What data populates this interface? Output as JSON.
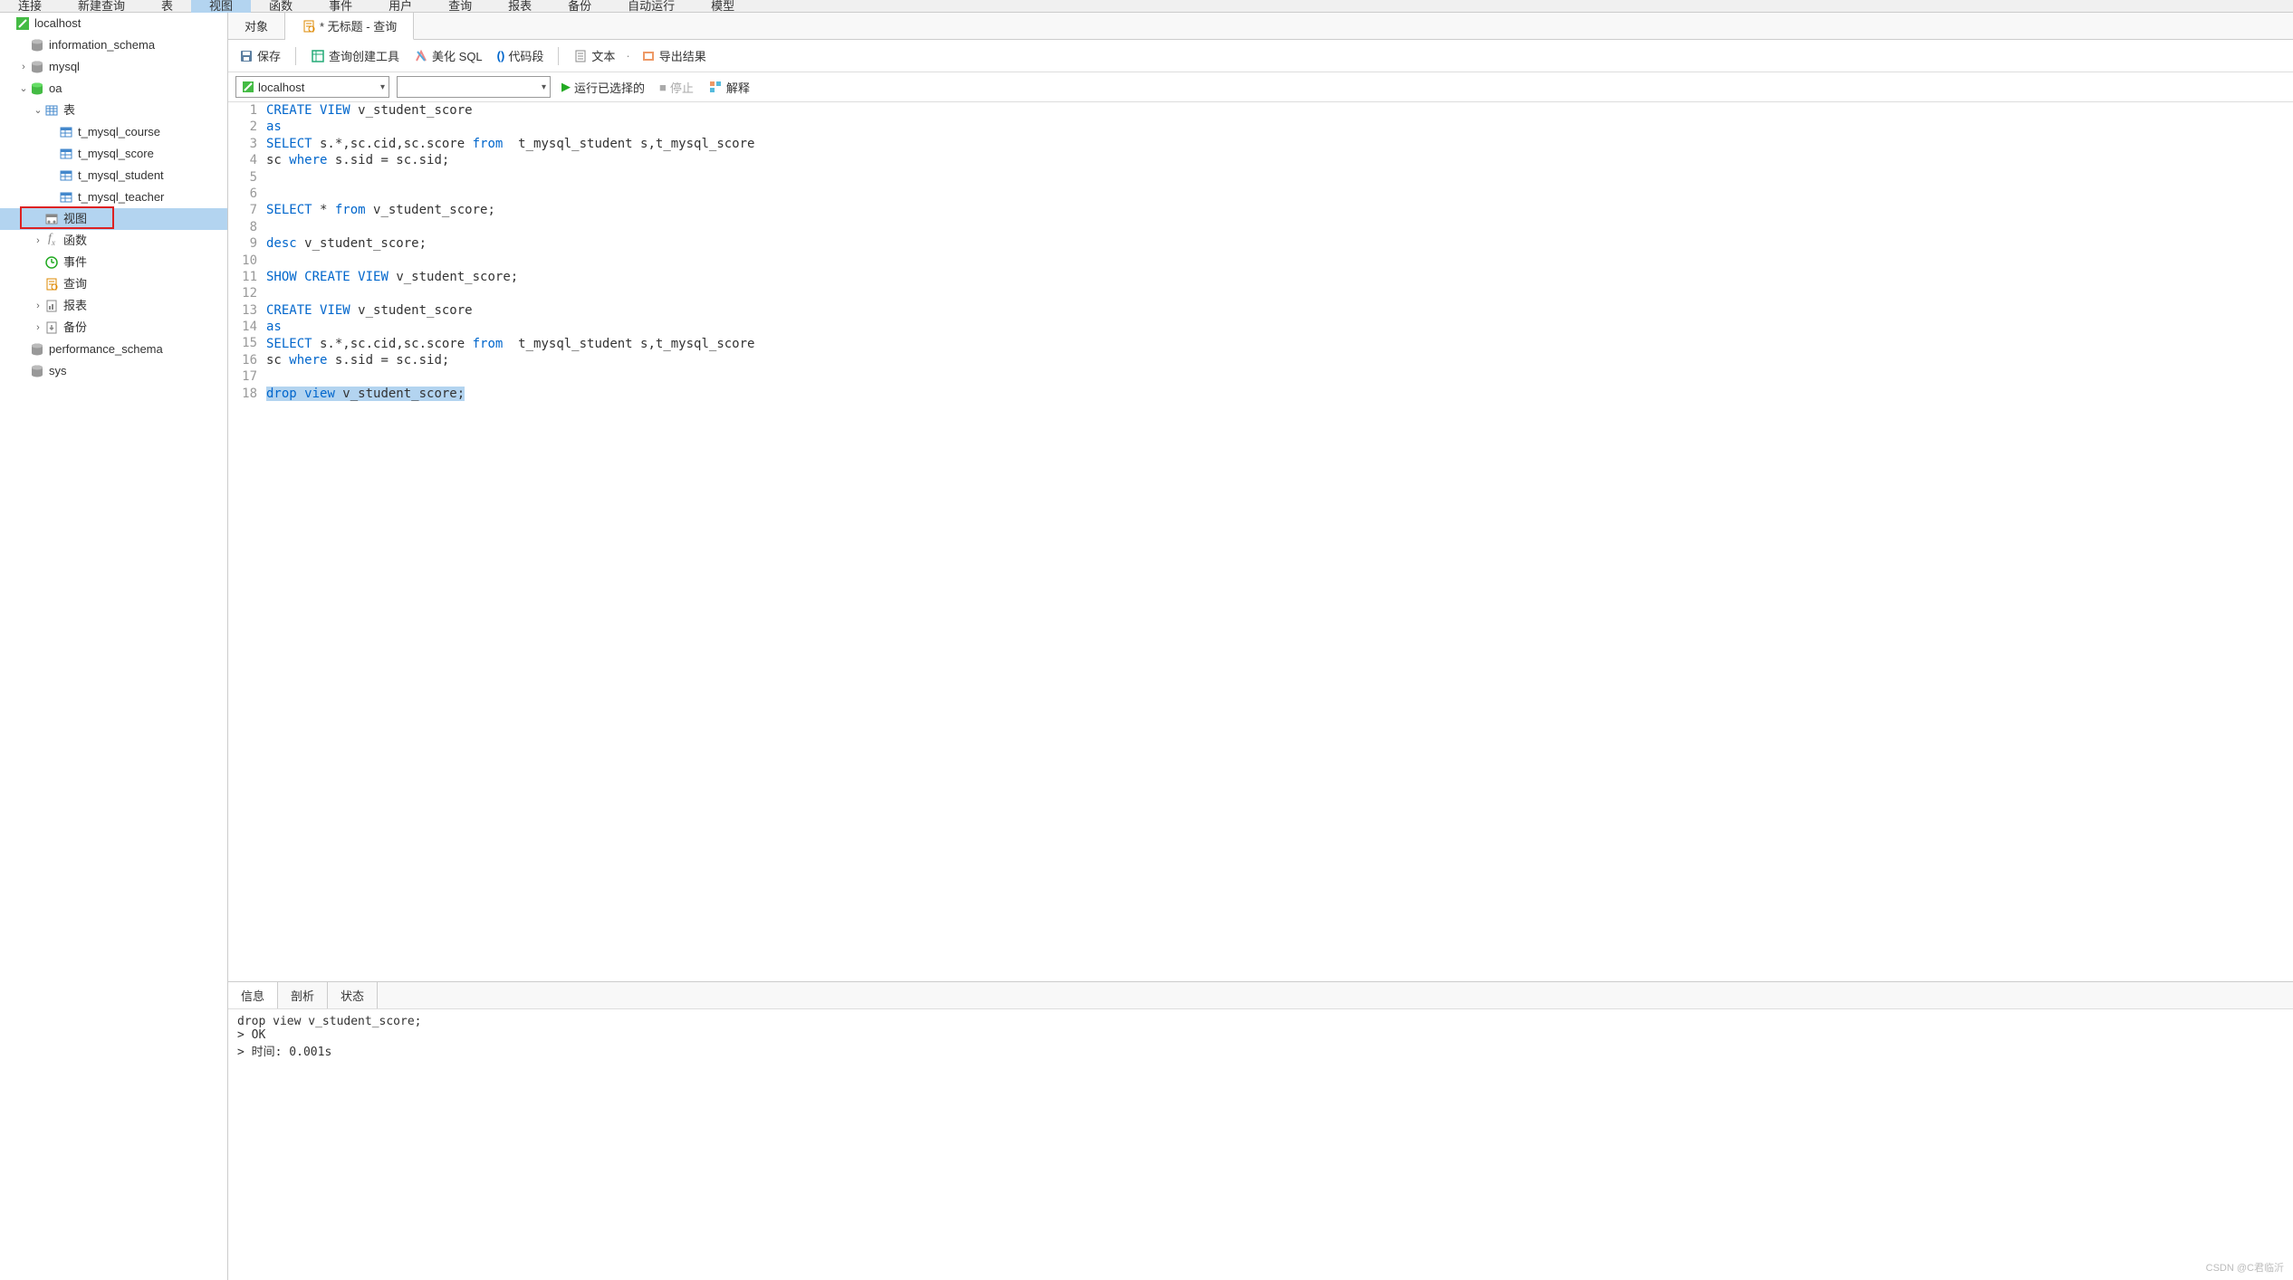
{
  "menu": {
    "items": [
      "连接",
      "新建查询",
      "表",
      "视图",
      "函数",
      "事件",
      "用户",
      "查询",
      "报表",
      "备份",
      "自动运行",
      "模型"
    ],
    "active_index": 3
  },
  "sidebar": {
    "nodes": [
      {
        "label": "localhost",
        "icon": "connection-icon",
        "indent": 0,
        "toggle": null
      },
      {
        "label": "information_schema",
        "icon": "database-icon",
        "indent": 1,
        "toggle": null
      },
      {
        "label": "mysql",
        "icon": "database-icon",
        "indent": 1,
        "toggle": "closed"
      },
      {
        "label": "oa",
        "icon": "database-icon-open",
        "indent": 1,
        "toggle": "open"
      },
      {
        "label": "表",
        "icon": "tables-icon",
        "indent": 2,
        "toggle": "open"
      },
      {
        "label": "t_mysql_course",
        "icon": "table-icon",
        "indent": 3,
        "toggle": null
      },
      {
        "label": "t_mysql_score",
        "icon": "table-icon",
        "indent": 3,
        "toggle": null
      },
      {
        "label": "t_mysql_student",
        "icon": "table-icon",
        "indent": 3,
        "toggle": null
      },
      {
        "label": "t_mysql_teacher",
        "icon": "table-icon",
        "indent": 3,
        "toggle": null
      },
      {
        "label": "视图",
        "icon": "view-icon",
        "indent": 2,
        "toggle": null,
        "selected": true,
        "redbox": true
      },
      {
        "label": "函数",
        "icon": "function-icon",
        "indent": 2,
        "toggle": "closed"
      },
      {
        "label": "事件",
        "icon": "event-icon",
        "indent": 2,
        "toggle": null
      },
      {
        "label": "查询",
        "icon": "query-icon",
        "indent": 2,
        "toggle": null
      },
      {
        "label": "报表",
        "icon": "report-icon",
        "indent": 2,
        "toggle": "closed"
      },
      {
        "label": "备份",
        "icon": "backup-icon",
        "indent": 2,
        "toggle": "closed"
      },
      {
        "label": "performance_schema",
        "icon": "database-icon",
        "indent": 1,
        "toggle": null
      },
      {
        "label": "sys",
        "icon": "database-icon",
        "indent": 1,
        "toggle": null
      }
    ]
  },
  "tabs": {
    "items": [
      {
        "label": "对象",
        "icon": null,
        "active": false
      },
      {
        "label": "* 无标题 - 查询",
        "icon": "query-icon",
        "active": true
      }
    ]
  },
  "toolbar": {
    "save": "保存",
    "query_builder": "查询创建工具",
    "beautify": "美化 SQL",
    "snippet": "代码段",
    "text": "文本",
    "export": "导出结果"
  },
  "toolbar2": {
    "connection": "localhost",
    "database": "",
    "run_selected": "运行已选择的",
    "stop": "停止",
    "explain": "解释"
  },
  "editor": {
    "lines": [
      {
        "n": 1,
        "tokens": [
          [
            "kw",
            "CREATE"
          ],
          [
            " "
          ],
          [
            "kw",
            "VIEW"
          ],
          [
            " v_student_score"
          ]
        ]
      },
      {
        "n": 2,
        "tokens": [
          [
            "kw",
            "as"
          ]
        ]
      },
      {
        "n": 3,
        "tokens": [
          [
            "kw",
            "SELECT"
          ],
          [
            " s.*,sc.cid,sc.score "
          ],
          [
            "kw",
            "from"
          ],
          [
            "  t_mysql_student s,t_mysql_score"
          ]
        ]
      },
      {
        "n": 4,
        "tokens": [
          [
            "",
            "sc "
          ],
          [
            "kw",
            "where"
          ],
          [
            " s.sid = sc.sid;"
          ]
        ]
      },
      {
        "n": 5,
        "tokens": []
      },
      {
        "n": 6,
        "tokens": []
      },
      {
        "n": 7,
        "tokens": [
          [
            "kw",
            "SELECT"
          ],
          [
            " * "
          ],
          [
            "kw",
            "from"
          ],
          [
            " v_student_score;"
          ]
        ]
      },
      {
        "n": 8,
        "tokens": []
      },
      {
        "n": 9,
        "tokens": [
          [
            "kw",
            "desc"
          ],
          [
            " v_student_score;"
          ]
        ]
      },
      {
        "n": 10,
        "tokens": []
      },
      {
        "n": 11,
        "tokens": [
          [
            "kw",
            "SHOW"
          ],
          [
            " "
          ],
          [
            "kw",
            "CREATE"
          ],
          [
            " "
          ],
          [
            "kw",
            "VIEW"
          ],
          [
            " v_student_score;"
          ]
        ]
      },
      {
        "n": 12,
        "tokens": []
      },
      {
        "n": 13,
        "tokens": [
          [
            "kw",
            "CREATE"
          ],
          [
            " "
          ],
          [
            "kw",
            "VIEW"
          ],
          [
            " v_student_score"
          ]
        ]
      },
      {
        "n": 14,
        "tokens": [
          [
            "kw",
            "as"
          ]
        ]
      },
      {
        "n": 15,
        "tokens": [
          [
            "kw",
            "SELECT"
          ],
          [
            " s.*,sc.cid,sc.score "
          ],
          [
            "kw",
            "from"
          ],
          [
            "  t_mysql_student s,t_mysql_score"
          ]
        ]
      },
      {
        "n": 16,
        "tokens": [
          [
            "",
            "sc "
          ],
          [
            "kw",
            "where"
          ],
          [
            " s.sid = sc.sid;"
          ]
        ]
      },
      {
        "n": 17,
        "tokens": []
      },
      {
        "n": 18,
        "highlighted": true,
        "tokens": [
          [
            "kw",
            "drop"
          ],
          [
            " "
          ],
          [
            "kw",
            "view"
          ],
          [
            " v_student_score;"
          ]
        ]
      }
    ]
  },
  "result_tabs": {
    "items": [
      "信息",
      "剖析",
      "状态"
    ],
    "active_index": 0
  },
  "result_body": "drop view v_student_score;\n> OK\n> 时间: 0.001s",
  "watermark": "CSDN @C君临沂"
}
